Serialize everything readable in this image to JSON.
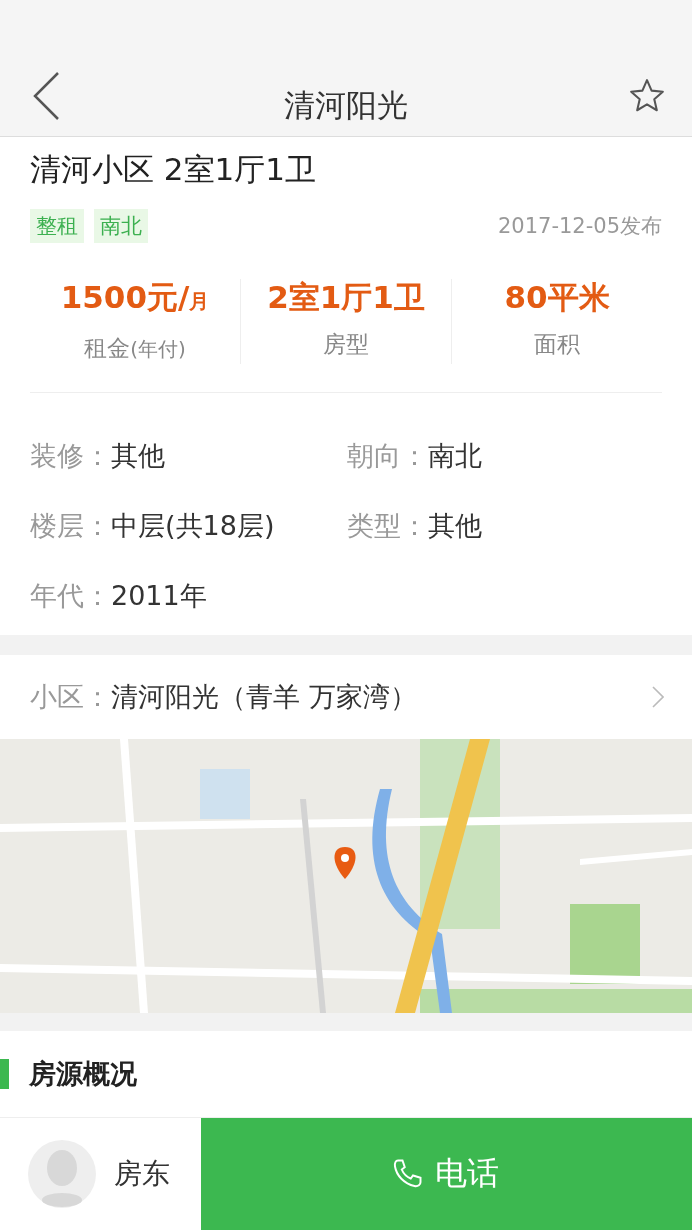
{
  "header": {
    "title": "清河阳光",
    "favorited": false
  },
  "listing": {
    "title": "清河小区 2室1厅1卫",
    "tags": [
      {
        "label": "整租"
      },
      {
        "label": "南北"
      }
    ],
    "published": "2017-12-05发布"
  },
  "stats": [
    {
      "value": "1500元/",
      "unit": "月",
      "label": "租金",
      "label_note": "(年付)"
    },
    {
      "value": "2室1厅1卫",
      "label": "房型"
    },
    {
      "value": "80平米",
      "label": "面积"
    }
  ],
  "details": [
    {
      "label": "装修：",
      "value": "其他"
    },
    {
      "label": "朝向：",
      "value": "南北"
    },
    {
      "label": "楼层：",
      "value": "中层(共18层)"
    },
    {
      "label": "类型：",
      "value": "其他"
    },
    {
      "label": "年代：",
      "value": "2011年"
    }
  ],
  "community": {
    "label": "小区：",
    "value": "清河阳光（青羊 万家湾）"
  },
  "section": {
    "title": "房源概况"
  },
  "bottom_bar": {
    "contact": "房东",
    "call": "电话"
  }
}
